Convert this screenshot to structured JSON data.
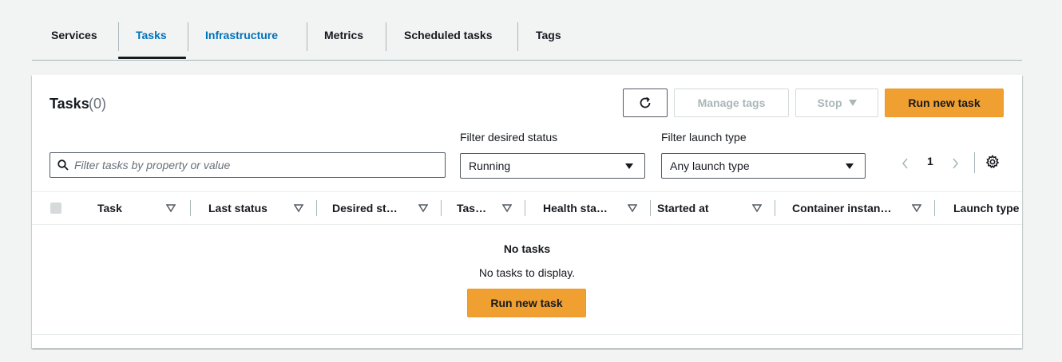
{
  "tabs": [
    {
      "label": "Services"
    },
    {
      "label": "Tasks"
    },
    {
      "label": "Infrastructure"
    },
    {
      "label": "Metrics"
    },
    {
      "label": "Scheduled tasks"
    },
    {
      "label": "Tags"
    }
  ],
  "panel": {
    "title": "Tasks",
    "count": "(0)",
    "manage_tags_label": "Manage tags",
    "stop_label": "Stop",
    "run_new_task_label": "Run new task"
  },
  "filters": {
    "search_placeholder": "Filter tasks by property or value",
    "desired_status_label": "Filter desired status",
    "desired_status_value": "Running",
    "launch_type_label": "Filter launch type",
    "launch_type_value": "Any launch type"
  },
  "pagination": {
    "current_page": "1"
  },
  "table": {
    "columns": [
      "Task",
      "Last status",
      "Desired st…",
      "Tas…",
      "Health sta…",
      "Started at",
      "Container instan…",
      "Launch type"
    ]
  },
  "empty_state": {
    "title": "No tasks",
    "message": "No tasks to display.",
    "button_label": "Run new task"
  },
  "colors": {
    "accent_link": "#0073bb",
    "primary_button": "#f0a030",
    "disabled_text": "#aab7b8"
  },
  "icons": [
    "refresh-icon",
    "caret-down-icon",
    "search-icon",
    "chevron-left-icon",
    "chevron-right-icon",
    "gear-icon",
    "sort-icon"
  ]
}
